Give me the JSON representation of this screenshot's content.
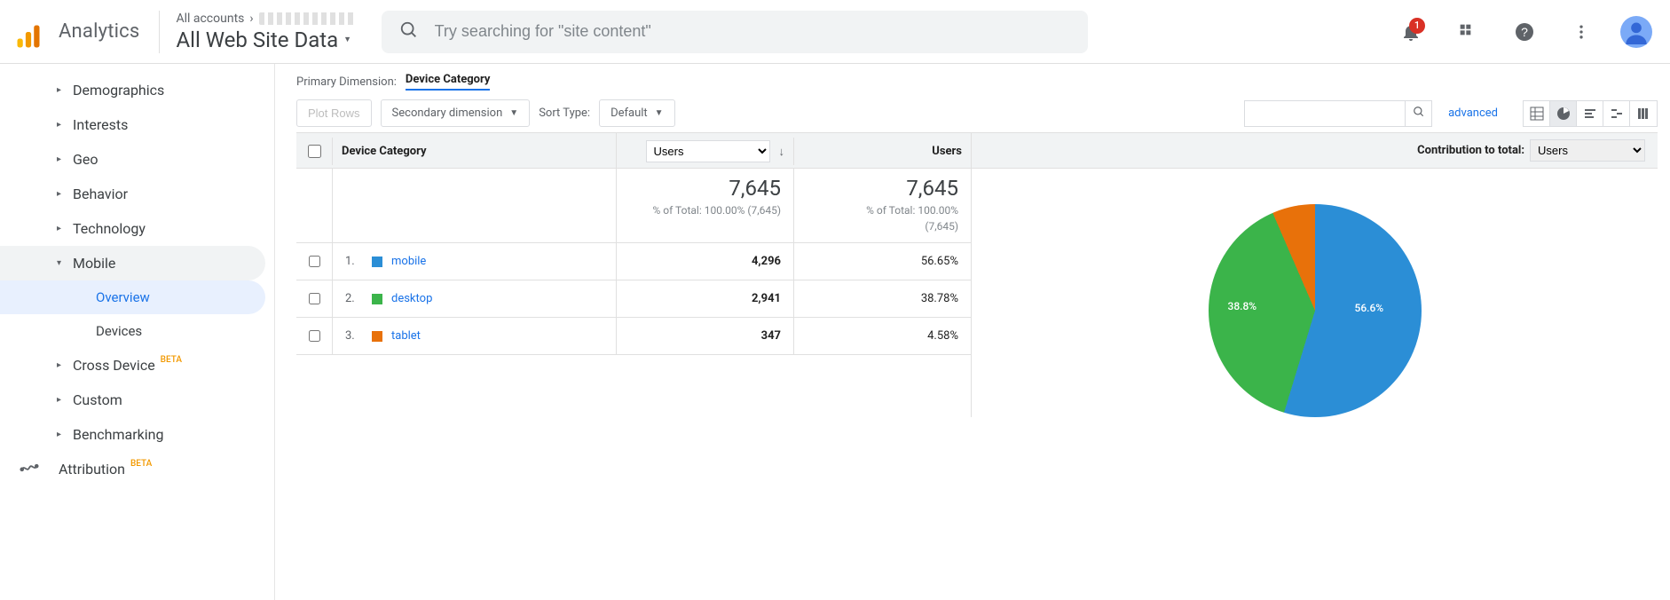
{
  "app": {
    "title": "Analytics",
    "breadcrumb_top": "All accounts",
    "property": "All Web Site Data"
  },
  "search": {
    "placeholder": "Try searching for \"site content\""
  },
  "notifications": {
    "count": "1"
  },
  "sidebar": {
    "items": [
      {
        "label": "Demographics"
      },
      {
        "label": "Interests"
      },
      {
        "label": "Geo"
      },
      {
        "label": "Behavior"
      },
      {
        "label": "Technology"
      },
      {
        "label": "Mobile",
        "open": true,
        "children": [
          {
            "label": "Overview",
            "active": true
          },
          {
            "label": "Devices"
          }
        ]
      },
      {
        "label": "Cross Device",
        "beta": "BETA"
      },
      {
        "label": "Custom"
      },
      {
        "label": "Benchmarking"
      }
    ],
    "attribution": {
      "label": "Attribution",
      "beta": "BETA"
    }
  },
  "primary_dimension": {
    "label": "Primary Dimension:",
    "value": "Device Category"
  },
  "toolbar": {
    "plot_rows": "Plot Rows",
    "secondary_dimension": "Secondary dimension",
    "sort_type_label": "Sort Type:",
    "sort_type_value": "Default",
    "advanced": "advanced"
  },
  "table": {
    "headers": {
      "dimension": "Device Category",
      "metric_select": "Users",
      "metric2": "Users",
      "contribution_label": "Contribution to total:",
      "contribution_metric": "Users"
    },
    "totals": {
      "value1": "7,645",
      "sub1": "% of Total: 100.00% (7,645)",
      "value2": "7,645",
      "sub2_a": "% of Total: 100.00%",
      "sub2_b": "(7,645)"
    },
    "rows": [
      {
        "num": "1.",
        "name": "mobile",
        "color": "#2b8ed6",
        "value": "4,296",
        "pct": "56.65%"
      },
      {
        "num": "2.",
        "name": "desktop",
        "color": "#3bb44a",
        "value": "2,941",
        "pct": "38.78%"
      },
      {
        "num": "3.",
        "name": "tablet",
        "color": "#e8710a",
        "value": "347",
        "pct": "4.58%"
      }
    ]
  },
  "chart_data": {
    "type": "pie",
    "title": "Contribution to total: Users",
    "series": [
      {
        "name": "mobile",
        "value": 56.65,
        "color": "#2b8ed6",
        "label": "56.6%"
      },
      {
        "name": "desktop",
        "value": 38.78,
        "color": "#3bb44a",
        "label": "38.8%"
      },
      {
        "name": "tablet",
        "value": 4.58,
        "color": "#e8710a",
        "label": ""
      }
    ]
  }
}
